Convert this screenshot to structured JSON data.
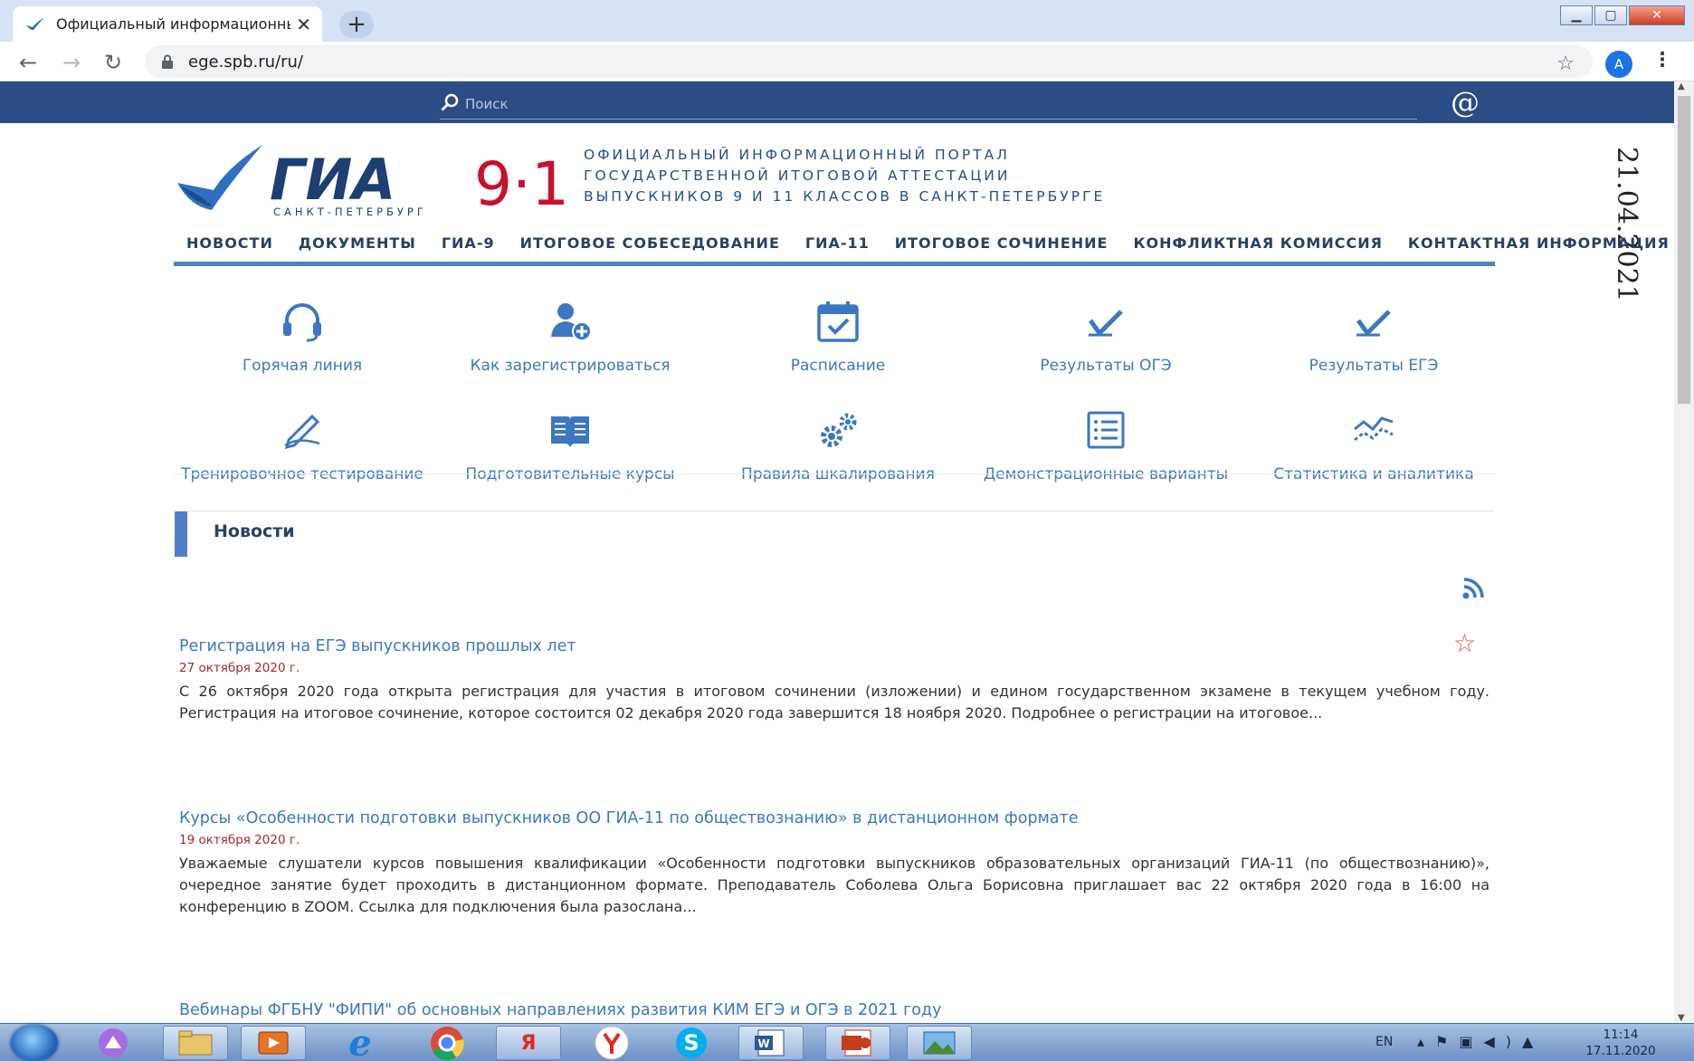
{
  "browser": {
    "tab_title": "Официальный информационны",
    "url": "ege.spb.ru/ru/",
    "profile_initial": "A"
  },
  "site": {
    "search_placeholder": "Поиск",
    "logo": {
      "main": "ГИА",
      "numbers": "9·11",
      "city": "САНКТ-ПЕТЕРБУРГ"
    },
    "portal_title": [
      "ОФИЦИАЛЬНЫЙ ИНФОРМАЦИОННЫЙ ПОРТАЛ",
      "ГОСУДАРСТВЕННОЙ ИТОГОВОЙ АТТЕСТАЦИИ",
      "ВЫПУСКНИКОВ 9 И 11 КЛАССОВ В САНКТ-ПЕТЕРБУРГЕ"
    ],
    "date_stamp": "21.04.2021",
    "nav": [
      "НОВОСТИ",
      "ДОКУМЕНТЫ",
      "ГИА-9",
      "ИТОГОВОЕ СОБЕСЕДОВАНИЕ",
      "ГИА-11",
      "ИТОГОВОЕ СОЧИНЕНИЕ",
      "КОНФЛИКТНАЯ КОМИССИЯ",
      "КОНТАКТНАЯ ИНФОРМАЦИЯ"
    ],
    "quick_links_row1": [
      {
        "label": "Горячая линия",
        "icon": "headset-icon"
      },
      {
        "label": "Как зарегистрироваться",
        "icon": "user-add-icon"
      },
      {
        "label": "Расписание",
        "icon": "calendar-check-icon"
      },
      {
        "label": "Результаты ОГЭ",
        "icon": "checkmark-icon"
      },
      {
        "label": "Результаты ЕГЭ",
        "icon": "checkmark-icon"
      }
    ],
    "quick_links_row2": [
      {
        "label": "Тренировочное тестирование",
        "icon": "pen-icon"
      },
      {
        "label": "Подготовительные курсы",
        "icon": "open-book-icon"
      },
      {
        "label": "Правила шкалирования",
        "icon": "gears-icon"
      },
      {
        "label": "Демонстрационные варианты",
        "icon": "document-list-icon"
      },
      {
        "label": "Статистика и аналитика",
        "icon": "chart-lines-icon"
      }
    ],
    "news_heading": "Новости",
    "news": [
      {
        "title": "Регистрация на ЕГЭ выпускников прошлых лет",
        "date": "27 октября 2020 г.",
        "text": "С 26 октября 2020 года открыта регистрация для участия в итоговом сочинении (изложении) и едином государственном экзамене в текущем учебном году. Регистрация на итоговое сочинение, которое состоится 02 декабря 2020 года завершится 18 ноября 2020. Подробнее о регистрации на итоговое..."
      },
      {
        "title": "Курсы «Особенности подготовки выпускников ОО ГИА-11 по обществознанию» в дистанционном формате",
        "date": "19 октября 2020 г.",
        "text": "Уважаемые слушатели курсов повышения квалификации «Особенности подготовки выпускников образовательных организаций ГИА-11 (по обществознанию)», очередное занятие будет проходить в дистанционном формате. Преподаватель Соболева Ольга Борисовна приглашает вас 22 октября 2020 года в 16:00 на конференцию в ZOOM. Ссылка для подключения была разослана..."
      },
      {
        "title": "Вебинары ФГБНУ \"ФИПИ\" об основных направлениях развития КИМ ЕГЭ и ОГЭ в 2021 году"
      }
    ]
  },
  "taskbar": {
    "yandex_letter": "Я",
    "lang": "EN",
    "time": "11:14",
    "date": "17.11.2020"
  },
  "colors": {
    "brand_blue": "#2b4c84",
    "link_blue": "#3b78c1",
    "accent_blue": "#4f7fc6",
    "logo_red": "#c8102e",
    "date_red": "#a52a2a"
  }
}
